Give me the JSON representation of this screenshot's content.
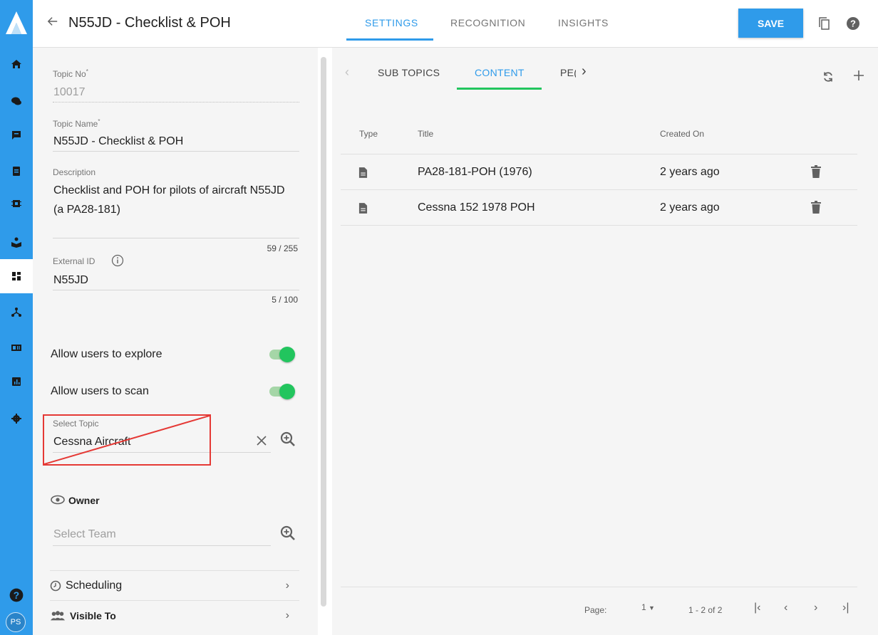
{
  "header": {
    "back_icon": "arrow-left-icon",
    "title": "N55JD - Checklist & POH",
    "tabs": [
      {
        "label": "SETTINGS",
        "active": true
      },
      {
        "label": "RECOGNITION",
        "active": false
      },
      {
        "label": "INSIGHTS",
        "active": false
      }
    ],
    "save_label": "SAVE",
    "icons": [
      "copy-icon",
      "help-icon"
    ]
  },
  "rail": {
    "icons": [
      "home-icon",
      "chat-icon",
      "message-icon",
      "clipboard-icon",
      "chip-icon",
      "book-icon",
      "dashboard-icon",
      "hierarchy-icon",
      "id-card-icon",
      "chart-icon",
      "gear-icon"
    ],
    "active_index": 6,
    "help_icon": "help-icon",
    "avatar_initials": "PS"
  },
  "form": {
    "topic_no": {
      "label": "Topic No",
      "required_mark": "*",
      "value": "10017"
    },
    "topic_name": {
      "label": "Topic Name",
      "required_mark": "*",
      "value": "N55JD - Checklist & POH"
    },
    "description": {
      "label": "Description",
      "line1": "Checklist and POH for pilots of aircraft N55JD",
      "line2": "(a PA28-181)",
      "counter": "59 / 255"
    },
    "external_id": {
      "label": "External ID",
      "value": "N55JD",
      "counter": "5 / 100"
    },
    "explore_label": "Allow users to explore",
    "explore_on": true,
    "scan_label": "Allow users to scan",
    "scan_on": true,
    "select_topic": {
      "label": "Select Topic",
      "value": "Cessna Aircraft"
    },
    "owner_label": "Owner",
    "select_team_placeholder": "Select Team",
    "scheduling_label": "Scheduling",
    "visible_to_label": "Visible To"
  },
  "content": {
    "sub_tabs": [
      {
        "label": "SUB TOPICS",
        "active": false
      },
      {
        "label": "CONTENT",
        "active": true
      },
      {
        "label": "PE(",
        "active": false
      }
    ],
    "columns": [
      "Type",
      "Title",
      "Created On"
    ],
    "rows": [
      {
        "type_icon": "document-icon",
        "title": "PA28-181-POH (1976)",
        "created": "2 years ago"
      },
      {
        "type_icon": "document-icon",
        "title": "Cessna 152 1978 POH",
        "created": "2 years ago"
      }
    ],
    "footer": {
      "page_label": "Page:",
      "page_value": "1",
      "range": "1 - 2 of 2"
    }
  },
  "colors": {
    "accent": "#2f9bea",
    "toggle": "#22c55e",
    "annotation": "#e53935"
  }
}
